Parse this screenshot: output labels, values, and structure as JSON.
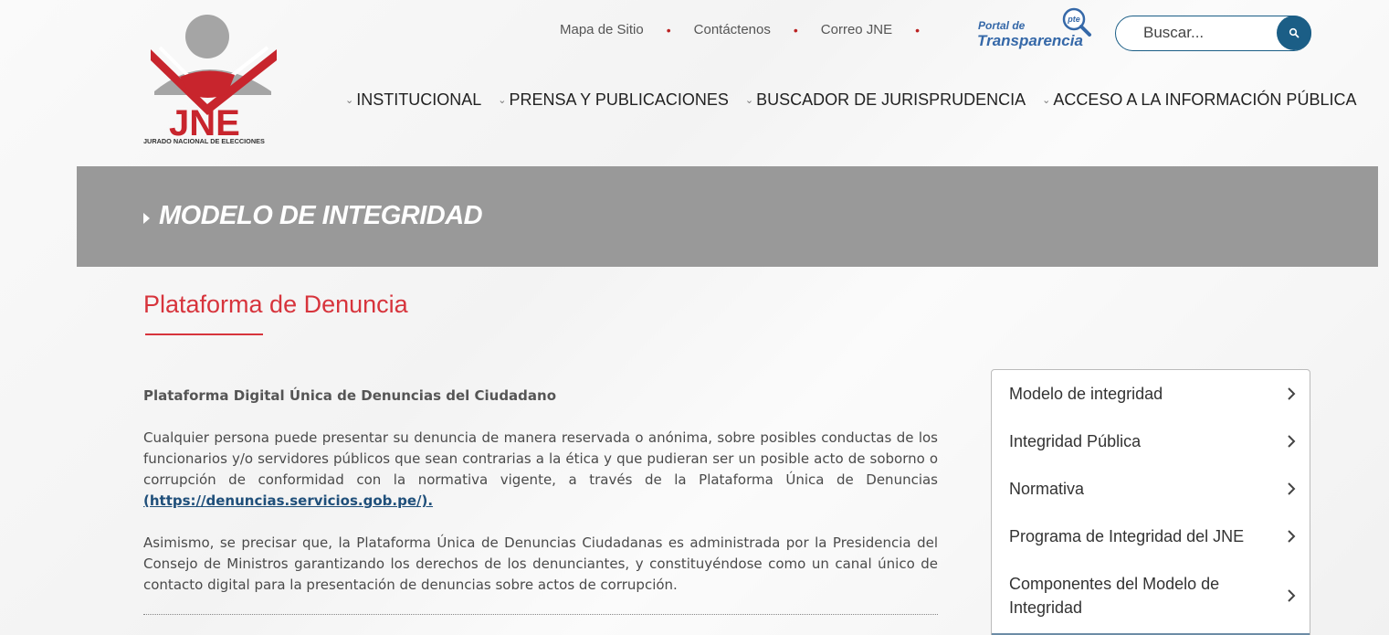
{
  "logo": {
    "text": "JNE",
    "subtitle": "JURADO NACIONAL DE ELECCIONES"
  },
  "top_links": [
    "Mapa de Sitio",
    "Contáctenos",
    "Correo JNE"
  ],
  "transparencia": {
    "line1": "Portal de",
    "line2": "Transparencia",
    "badge": "pte"
  },
  "search": {
    "placeholder": "Buscar..."
  },
  "nav": [
    "INSTITUCIONAL",
    "PRENSA Y PUBLICACIONES",
    "BUSCADOR DE JURISPRUDENCIA",
    "ACCESO A LA INFORMACIÓN PÚBLICA"
  ],
  "banner": {
    "title": "MODELO DE INTEGRIDAD"
  },
  "page": {
    "title": "Plataforma de Denuncia",
    "lead": "Plataforma Digital Única de Denuncias del Ciudadano",
    "para1": "Cualquier persona puede presentar su denuncia de manera reservada o anónima, sobre posibles conductas de los funcionarios y/o servidores públicos que sean contrarias a la ética y que pudieran ser un posible acto de soborno o corrupción de conformidad con la normativa vigente, a través de la Plataforma Única de Denuncias",
    "link": "(https://denuncias.servicios.gob.pe/).",
    "para2": "Asimismo, se precisar que, la Plataforma Única de Denuncias Ciudadanas es administrada por la Presidencia del Consejo de Ministros garantizando los derechos de los denunciantes, y constituyéndose como un canal único de contacto digital para la presentación de denuncias sobre actos de corrupción."
  },
  "sidebar": [
    "Modelo de integridad",
    "Integridad Pública",
    "Normativa",
    "Programa de Integridad del JNE",
    "Componentes del Modelo de Integridad"
  ],
  "colors": {
    "accent": "#d7343c",
    "link": "#1f4f7a",
    "banner": "#999999",
    "search": "#1b5e86"
  }
}
